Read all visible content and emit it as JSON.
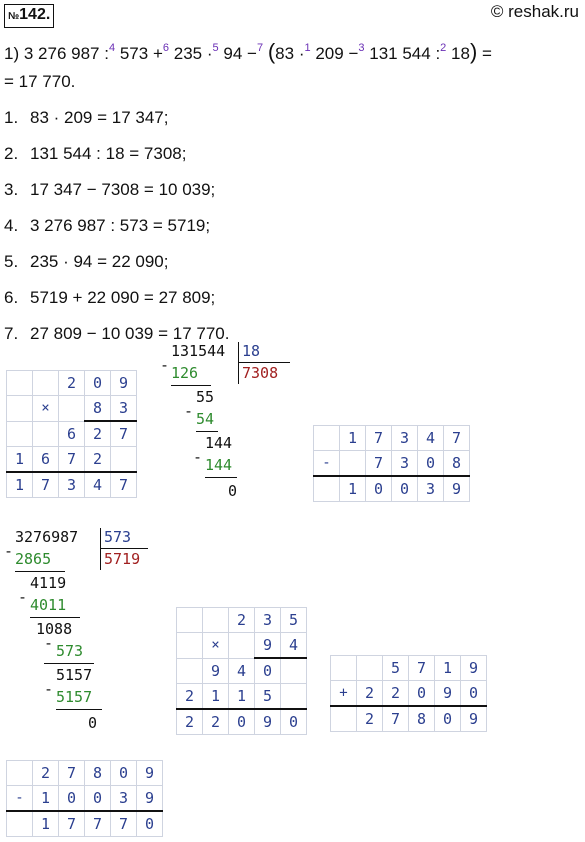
{
  "header": {
    "problem_number_prefix": "№",
    "problem_number": "142.",
    "copyright": "© reshak.ru"
  },
  "expression": {
    "label": "1)",
    "a": "3 276 987",
    "op1": ":",
    "o4": "4",
    "b": "573",
    "op2": "+",
    "o6": "6",
    "c": "235",
    "op3": "·",
    "o5": "5",
    "d": "94",
    "op4": "−",
    "o7": "7",
    "e": "83",
    "op5": "·",
    "o1": "1",
    "f": "209",
    "op6": "−",
    "o3": "3",
    "g": "131 544",
    "op7": ":",
    "o2": "2",
    "h": "18",
    "eq": "=",
    "result_line": "= 17 770."
  },
  "steps": [
    {
      "n": "1.",
      "text": "83 · 209 = 17 347;"
    },
    {
      "n": "2.",
      "text": "131 544 : 18 = 7308;"
    },
    {
      "n": "3.",
      "text": "17 347 − 7308 = 10 039;"
    },
    {
      "n": "4.",
      "text": "3 276 987 : 573 = 5719;"
    },
    {
      "n": "5.",
      "text": "235 · 94 = 22 090;"
    },
    {
      "n": "6.",
      "text": "5719 + 22 090 = 27 809;"
    },
    {
      "n": "7.",
      "text": "27 809 − 10 039 = 17 770."
    }
  ],
  "mult1": {
    "sign": "×",
    "rows": [
      [
        "",
        "",
        "2",
        "0",
        "9"
      ],
      [
        "",
        "",
        "",
        "8",
        "3"
      ],
      [
        "",
        "",
        "6",
        "2",
        "7"
      ],
      [
        "1",
        "6",
        "7",
        "2",
        ""
      ],
      [
        "1",
        "7",
        "3",
        "4",
        "7"
      ]
    ]
  },
  "div1": {
    "dividend": "131544",
    "divisor": "18",
    "quotient": "7308",
    "lines": [
      "126",
      "55",
      "54",
      "144",
      "144",
      "0"
    ]
  },
  "sub1": {
    "sign": "-",
    "rows": [
      [
        "",
        "1",
        "7",
        "3",
        "4",
        "7"
      ],
      [
        "",
        "",
        "7",
        "3",
        "0",
        "8"
      ],
      [
        "",
        "1",
        "0",
        "0",
        "3",
        "9"
      ]
    ]
  },
  "div2": {
    "dividend": "3276987",
    "divisor": "573",
    "quotient": "5719",
    "lines": [
      "2865",
      "4119",
      "4011",
      "1088",
      "573",
      "5157",
      "5157",
      "0"
    ]
  },
  "mult2": {
    "sign": "×",
    "rows": [
      [
        "",
        "",
        "2",
        "3",
        "5"
      ],
      [
        "",
        "",
        "",
        "9",
        "4"
      ],
      [
        "",
        "9",
        "4",
        "0",
        ""
      ],
      [
        "2",
        "1",
        "1",
        "5",
        ""
      ],
      [
        "2",
        "2",
        "0",
        "9",
        "0"
      ]
    ]
  },
  "add1": {
    "sign": "+",
    "rows": [
      [
        "",
        "",
        "5",
        "7",
        "1",
        "9"
      ],
      [
        "",
        "2",
        "2",
        "0",
        "9",
        "0"
      ],
      [
        "",
        "2",
        "7",
        "8",
        "0",
        "9"
      ]
    ]
  },
  "sub2": {
    "sign": "-",
    "rows": [
      [
        "",
        "2",
        "7",
        "8",
        "0",
        "9"
      ],
      [
        "",
        "1",
        "0",
        "0",
        "3",
        "9"
      ],
      [
        "",
        "1",
        "7",
        "7",
        "7",
        "0"
      ]
    ]
  }
}
